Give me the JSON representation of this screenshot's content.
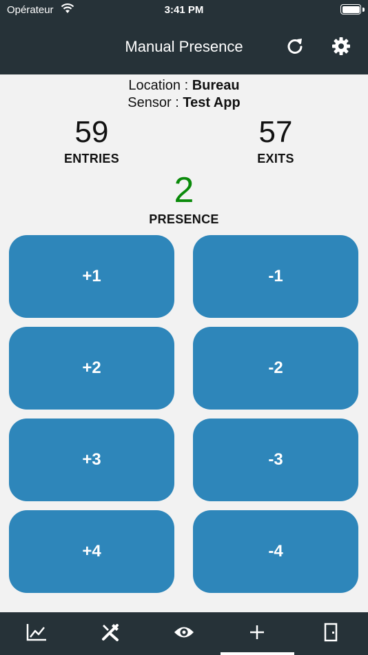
{
  "status_bar": {
    "carrier": "Opérateur",
    "time": "3:41 PM"
  },
  "header": {
    "title": "Manual Presence",
    "refresh_icon": "refresh-icon",
    "settings_icon": "gear-icon"
  },
  "info": {
    "location_label": "Location : ",
    "location_value": "Bureau",
    "sensor_label": "Sensor : ",
    "sensor_value": "Test App"
  },
  "stats": {
    "entries": {
      "value": "59",
      "label": "ENTRIES"
    },
    "exits": {
      "value": "57",
      "label": "EXITS"
    },
    "presence": {
      "value": "2",
      "label": "PRESENCE",
      "color": "#0a8a0a"
    }
  },
  "buttons": {
    "plus1": "+1",
    "minus1": "-1",
    "plus2": "+2",
    "minus2": "-2",
    "plus3": "+3",
    "minus3": "-3",
    "plus4": "+4",
    "minus4": "-4"
  },
  "tabbar": {
    "tabs": [
      "chart-line-icon",
      "tools-icon",
      "eye-icon",
      "plus-icon",
      "door-icon"
    ],
    "active": "plus-icon"
  },
  "colors": {
    "header_bg": "#263238",
    "button_bg": "#2e86ba",
    "page_bg": "#f2f2f2"
  }
}
